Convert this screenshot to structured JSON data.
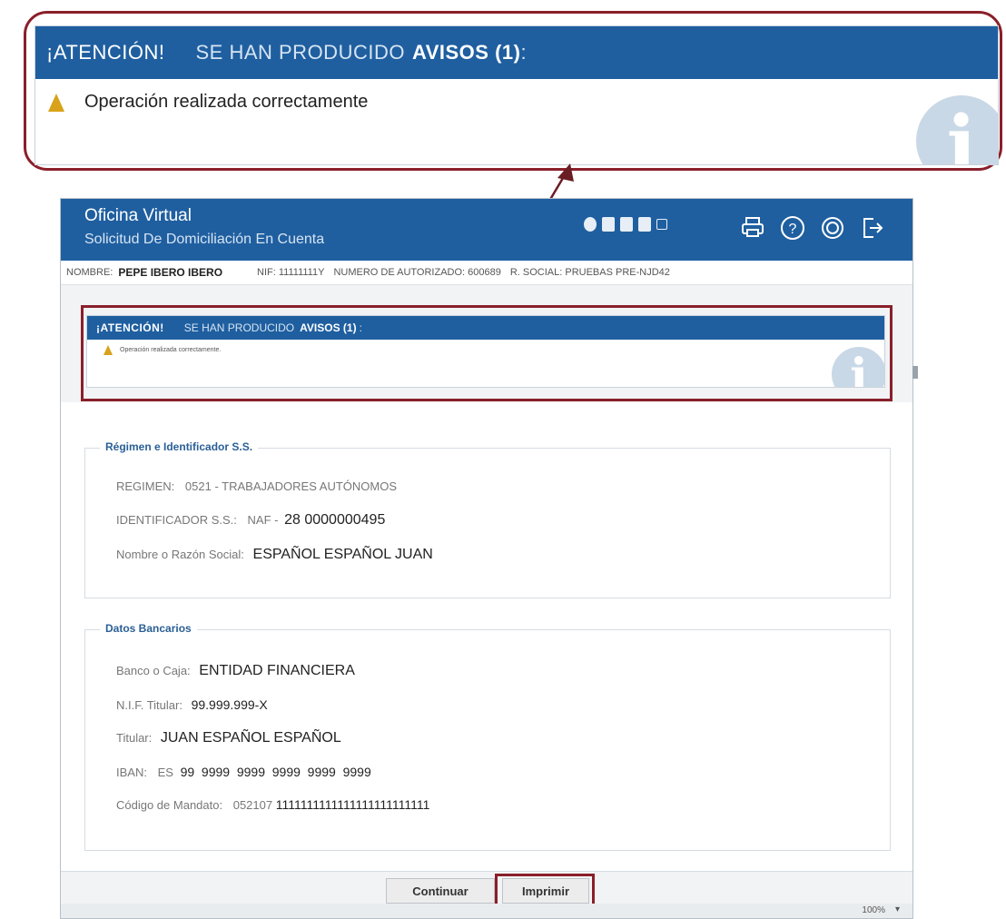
{
  "alert": {
    "attention": "¡ATENCIÓN!",
    "subtitle": "SE HAN PRODUCIDO",
    "avisos": "AVISOS (1)",
    "avisos_colon": ":",
    "message": "Operación realizada correctamente",
    "message_small": "Operación realizada correctamente."
  },
  "header": {
    "title": "Oficina Virtual",
    "subtitle": "Solicitud De Domiciliación En Cuenta",
    "tool_icons": [
      "accessibility-icon",
      "document-icon",
      "document-icon",
      "document-icon",
      "resize-icon"
    ],
    "action_icons": [
      "print-icon",
      "help-icon",
      "settings-icon",
      "logout-icon"
    ]
  },
  "info": {
    "nombre_label": "NOMBRE:",
    "nombre_value": "PEPE IBERO IBERO",
    "nif": "NIF: 11111111Y",
    "autorizado": "NUMERO DE AUTORIZADO: 600689",
    "razon": "R. SOCIAL: PRUEBAS PRE-NJD42"
  },
  "regimen": {
    "legend": "Régimen e Identificador S.S.",
    "regimen_label": "REGIMEN:",
    "regimen_value": "0521 - TRABAJADORES AUTÓNOMOS",
    "ident_label": "IDENTIFICADOR S.S.:",
    "ident_prefix": "NAF -",
    "ident_value": "28 0000000495",
    "nombre_label": "Nombre o Razón Social:",
    "nombre_value": "ESPAÑOL ESPAÑOL JUAN"
  },
  "banco": {
    "legend": "Datos Bancarios",
    "banco_label": "Banco o Caja:",
    "banco_value": "ENTIDAD FINANCIERA",
    "nif_label": "N.I.F. Titular:",
    "nif_value": "99.999.999-X",
    "titular_label": "Titular:",
    "titular_value": "JUAN ESPAÑOL ESPAÑOL",
    "iban_label": "IBAN:",
    "iban_country": "ES",
    "iban_value": "99  9999  9999  9999  9999  9999",
    "mandato_label": "Código de Mandato:",
    "mandato_prefix": "052107",
    "mandato_value": "1111111111111111111111111"
  },
  "buttons": {
    "continuar": "Continuar",
    "imprimir": "Imprimir"
  },
  "status": {
    "zoom": "100%",
    "caret": "▾"
  },
  "colors": {
    "header_blue": "#1f5fa0",
    "highlight": "#8a1f2a",
    "warning": "#d8a21a",
    "legend_blue": "#2a5f96"
  }
}
